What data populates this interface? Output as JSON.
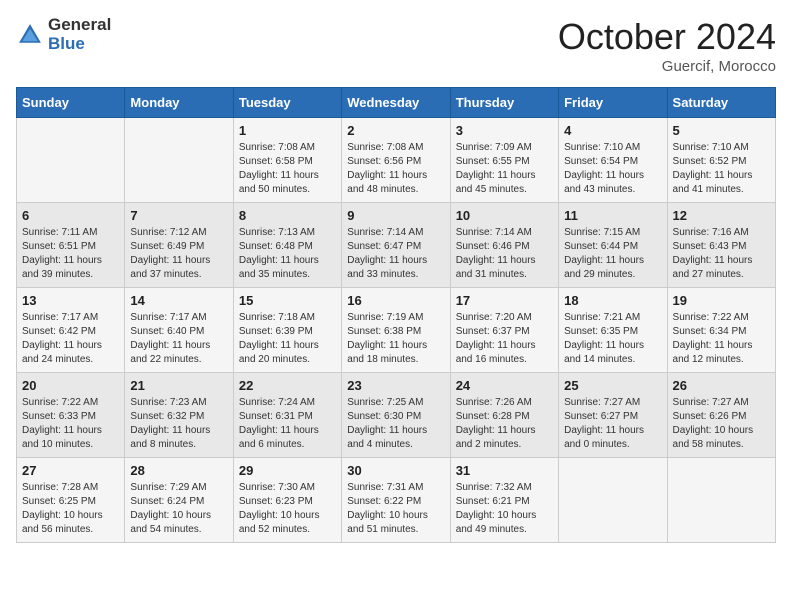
{
  "header": {
    "logo_general": "General",
    "logo_blue": "Blue",
    "month_title": "October 2024",
    "location": "Guercif, Morocco"
  },
  "days_of_week": [
    "Sunday",
    "Monday",
    "Tuesday",
    "Wednesday",
    "Thursday",
    "Friday",
    "Saturday"
  ],
  "weeks": [
    [
      {
        "day": "",
        "sunrise": "",
        "sunset": "",
        "daylight": ""
      },
      {
        "day": "",
        "sunrise": "",
        "sunset": "",
        "daylight": ""
      },
      {
        "day": "1",
        "sunrise": "Sunrise: 7:08 AM",
        "sunset": "Sunset: 6:58 PM",
        "daylight": "Daylight: 11 hours and 50 minutes."
      },
      {
        "day": "2",
        "sunrise": "Sunrise: 7:08 AM",
        "sunset": "Sunset: 6:56 PM",
        "daylight": "Daylight: 11 hours and 48 minutes."
      },
      {
        "day": "3",
        "sunrise": "Sunrise: 7:09 AM",
        "sunset": "Sunset: 6:55 PM",
        "daylight": "Daylight: 11 hours and 45 minutes."
      },
      {
        "day": "4",
        "sunrise": "Sunrise: 7:10 AM",
        "sunset": "Sunset: 6:54 PM",
        "daylight": "Daylight: 11 hours and 43 minutes."
      },
      {
        "day": "5",
        "sunrise": "Sunrise: 7:10 AM",
        "sunset": "Sunset: 6:52 PM",
        "daylight": "Daylight: 11 hours and 41 minutes."
      }
    ],
    [
      {
        "day": "6",
        "sunrise": "Sunrise: 7:11 AM",
        "sunset": "Sunset: 6:51 PM",
        "daylight": "Daylight: 11 hours and 39 minutes."
      },
      {
        "day": "7",
        "sunrise": "Sunrise: 7:12 AM",
        "sunset": "Sunset: 6:49 PM",
        "daylight": "Daylight: 11 hours and 37 minutes."
      },
      {
        "day": "8",
        "sunrise": "Sunrise: 7:13 AM",
        "sunset": "Sunset: 6:48 PM",
        "daylight": "Daylight: 11 hours and 35 minutes."
      },
      {
        "day": "9",
        "sunrise": "Sunrise: 7:14 AM",
        "sunset": "Sunset: 6:47 PM",
        "daylight": "Daylight: 11 hours and 33 minutes."
      },
      {
        "day": "10",
        "sunrise": "Sunrise: 7:14 AM",
        "sunset": "Sunset: 6:46 PM",
        "daylight": "Daylight: 11 hours and 31 minutes."
      },
      {
        "day": "11",
        "sunrise": "Sunrise: 7:15 AM",
        "sunset": "Sunset: 6:44 PM",
        "daylight": "Daylight: 11 hours and 29 minutes."
      },
      {
        "day": "12",
        "sunrise": "Sunrise: 7:16 AM",
        "sunset": "Sunset: 6:43 PM",
        "daylight": "Daylight: 11 hours and 27 minutes."
      }
    ],
    [
      {
        "day": "13",
        "sunrise": "Sunrise: 7:17 AM",
        "sunset": "Sunset: 6:42 PM",
        "daylight": "Daylight: 11 hours and 24 minutes."
      },
      {
        "day": "14",
        "sunrise": "Sunrise: 7:17 AM",
        "sunset": "Sunset: 6:40 PM",
        "daylight": "Daylight: 11 hours and 22 minutes."
      },
      {
        "day": "15",
        "sunrise": "Sunrise: 7:18 AM",
        "sunset": "Sunset: 6:39 PM",
        "daylight": "Daylight: 11 hours and 20 minutes."
      },
      {
        "day": "16",
        "sunrise": "Sunrise: 7:19 AM",
        "sunset": "Sunset: 6:38 PM",
        "daylight": "Daylight: 11 hours and 18 minutes."
      },
      {
        "day": "17",
        "sunrise": "Sunrise: 7:20 AM",
        "sunset": "Sunset: 6:37 PM",
        "daylight": "Daylight: 11 hours and 16 minutes."
      },
      {
        "day": "18",
        "sunrise": "Sunrise: 7:21 AM",
        "sunset": "Sunset: 6:35 PM",
        "daylight": "Daylight: 11 hours and 14 minutes."
      },
      {
        "day": "19",
        "sunrise": "Sunrise: 7:22 AM",
        "sunset": "Sunset: 6:34 PM",
        "daylight": "Daylight: 11 hours and 12 minutes."
      }
    ],
    [
      {
        "day": "20",
        "sunrise": "Sunrise: 7:22 AM",
        "sunset": "Sunset: 6:33 PM",
        "daylight": "Daylight: 11 hours and 10 minutes."
      },
      {
        "day": "21",
        "sunrise": "Sunrise: 7:23 AM",
        "sunset": "Sunset: 6:32 PM",
        "daylight": "Daylight: 11 hours and 8 minutes."
      },
      {
        "day": "22",
        "sunrise": "Sunrise: 7:24 AM",
        "sunset": "Sunset: 6:31 PM",
        "daylight": "Daylight: 11 hours and 6 minutes."
      },
      {
        "day": "23",
        "sunrise": "Sunrise: 7:25 AM",
        "sunset": "Sunset: 6:30 PM",
        "daylight": "Daylight: 11 hours and 4 minutes."
      },
      {
        "day": "24",
        "sunrise": "Sunrise: 7:26 AM",
        "sunset": "Sunset: 6:28 PM",
        "daylight": "Daylight: 11 hours and 2 minutes."
      },
      {
        "day": "25",
        "sunrise": "Sunrise: 7:27 AM",
        "sunset": "Sunset: 6:27 PM",
        "daylight": "Daylight: 11 hours and 0 minutes."
      },
      {
        "day": "26",
        "sunrise": "Sunrise: 7:27 AM",
        "sunset": "Sunset: 6:26 PM",
        "daylight": "Daylight: 10 hours and 58 minutes."
      }
    ],
    [
      {
        "day": "27",
        "sunrise": "Sunrise: 7:28 AM",
        "sunset": "Sunset: 6:25 PM",
        "daylight": "Daylight: 10 hours and 56 minutes."
      },
      {
        "day": "28",
        "sunrise": "Sunrise: 7:29 AM",
        "sunset": "Sunset: 6:24 PM",
        "daylight": "Daylight: 10 hours and 54 minutes."
      },
      {
        "day": "29",
        "sunrise": "Sunrise: 7:30 AM",
        "sunset": "Sunset: 6:23 PM",
        "daylight": "Daylight: 10 hours and 52 minutes."
      },
      {
        "day": "30",
        "sunrise": "Sunrise: 7:31 AM",
        "sunset": "Sunset: 6:22 PM",
        "daylight": "Daylight: 10 hours and 51 minutes."
      },
      {
        "day": "31",
        "sunrise": "Sunrise: 7:32 AM",
        "sunset": "Sunset: 6:21 PM",
        "daylight": "Daylight: 10 hours and 49 minutes."
      },
      {
        "day": "",
        "sunrise": "",
        "sunset": "",
        "daylight": ""
      },
      {
        "day": "",
        "sunrise": "",
        "sunset": "",
        "daylight": ""
      }
    ]
  ]
}
